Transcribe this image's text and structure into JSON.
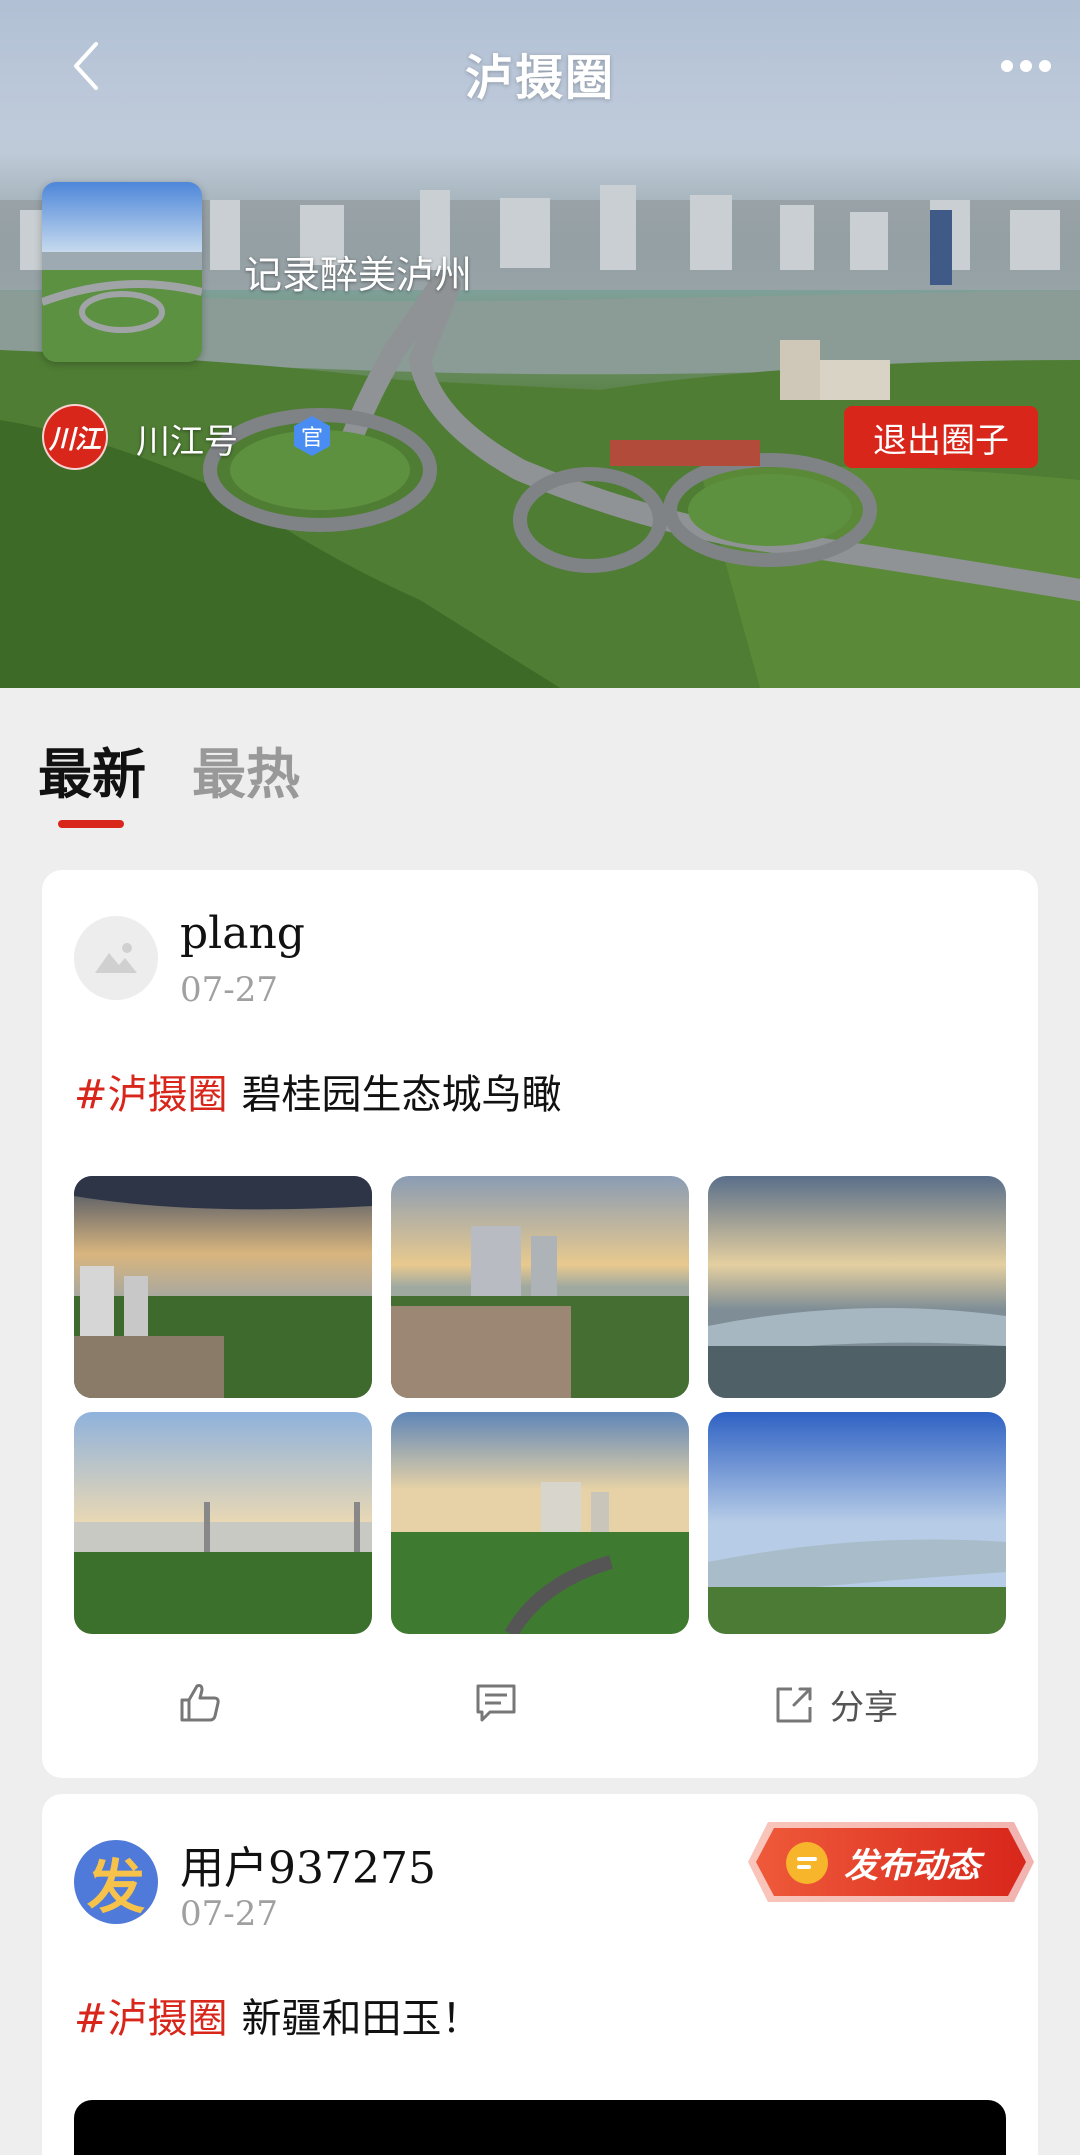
{
  "header": {
    "title": "泸摄圈",
    "circle_description": "记录醉美泸州",
    "owner_name": "川江号",
    "owner_avatar_text": "川江",
    "official_badge": "官",
    "exit_label": "退出圈子"
  },
  "tabs": [
    {
      "label": "最新",
      "active": true
    },
    {
      "label": "最热",
      "active": false
    }
  ],
  "posts": [
    {
      "user": "plang",
      "date": "07-27",
      "hashtag": "#泸摄圈",
      "text": "碧桂园生态城鸟瞰",
      "images": 6,
      "actions": {
        "share_label": "分享"
      }
    },
    {
      "user": "用户937275",
      "avatar_text": "发",
      "date": "07-27",
      "hashtag": "#泸摄圈",
      "text": "新疆和田玉！"
    }
  ],
  "publish_button": {
    "label": "发布动态"
  },
  "colors": {
    "accent": "#d8261b",
    "badge_blue": "#4a8df2",
    "background": "#eeeeee"
  }
}
